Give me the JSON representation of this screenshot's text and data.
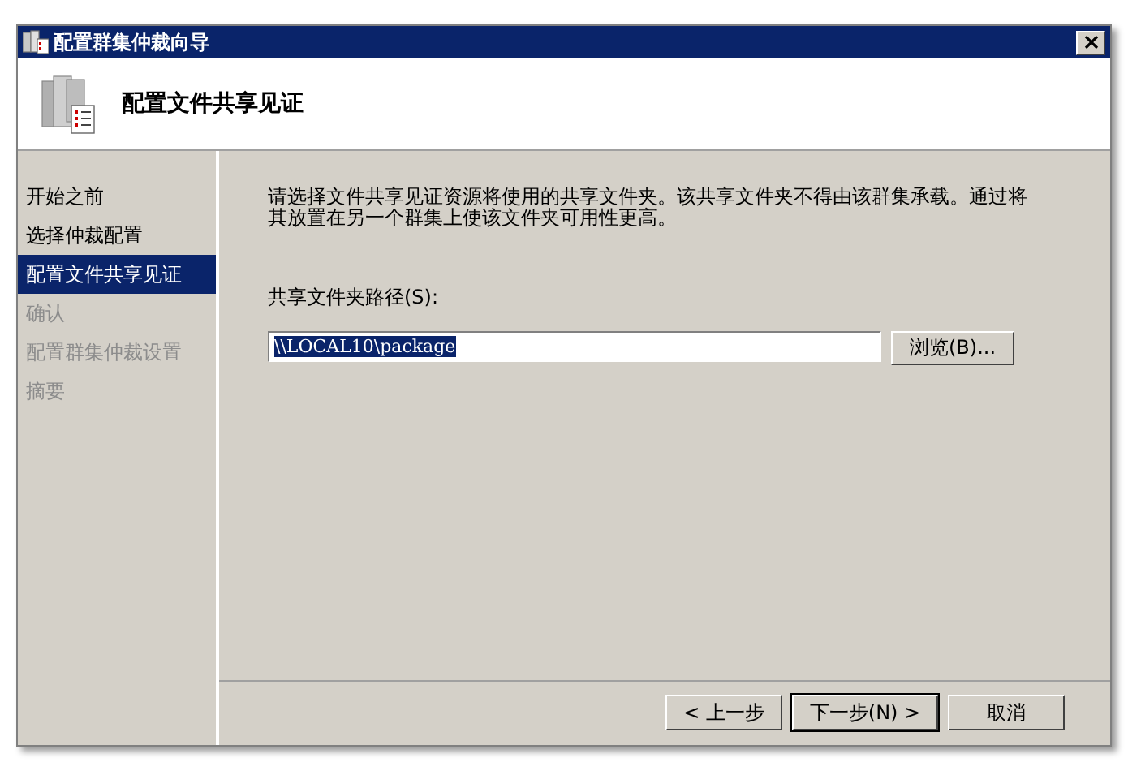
{
  "window": {
    "title": "配置群集仲裁向导"
  },
  "header": {
    "title": "配置文件共享见证"
  },
  "steps": [
    {
      "label": "开始之前",
      "selected": false,
      "disabled": false
    },
    {
      "label": "选择仲裁配置",
      "selected": false,
      "disabled": false
    },
    {
      "label": "配置文件共享见证",
      "selected": true,
      "disabled": false
    },
    {
      "label": "确认",
      "selected": false,
      "disabled": true
    },
    {
      "label": "配置群集仲裁设置",
      "selected": false,
      "disabled": true
    },
    {
      "label": "摘要",
      "selected": false,
      "disabled": true
    }
  ],
  "content": {
    "description": "请选择文件共享见证资源将使用的共享文件夹。该共享文件夹不得由该群集承载。通过将其放置在另一个群集上使该文件夹可用性更高。",
    "path_label": "共享文件夹路径(S):",
    "path_value": "\\\\LOCAL10\\package",
    "path_value_selected": true,
    "browse_button": "浏览(B)..."
  },
  "buttons": [
    {
      "label": "< 上一步",
      "default": false
    },
    {
      "label": "下一步(N) >",
      "default": true
    },
    {
      "label": "取消",
      "default": false
    }
  ]
}
